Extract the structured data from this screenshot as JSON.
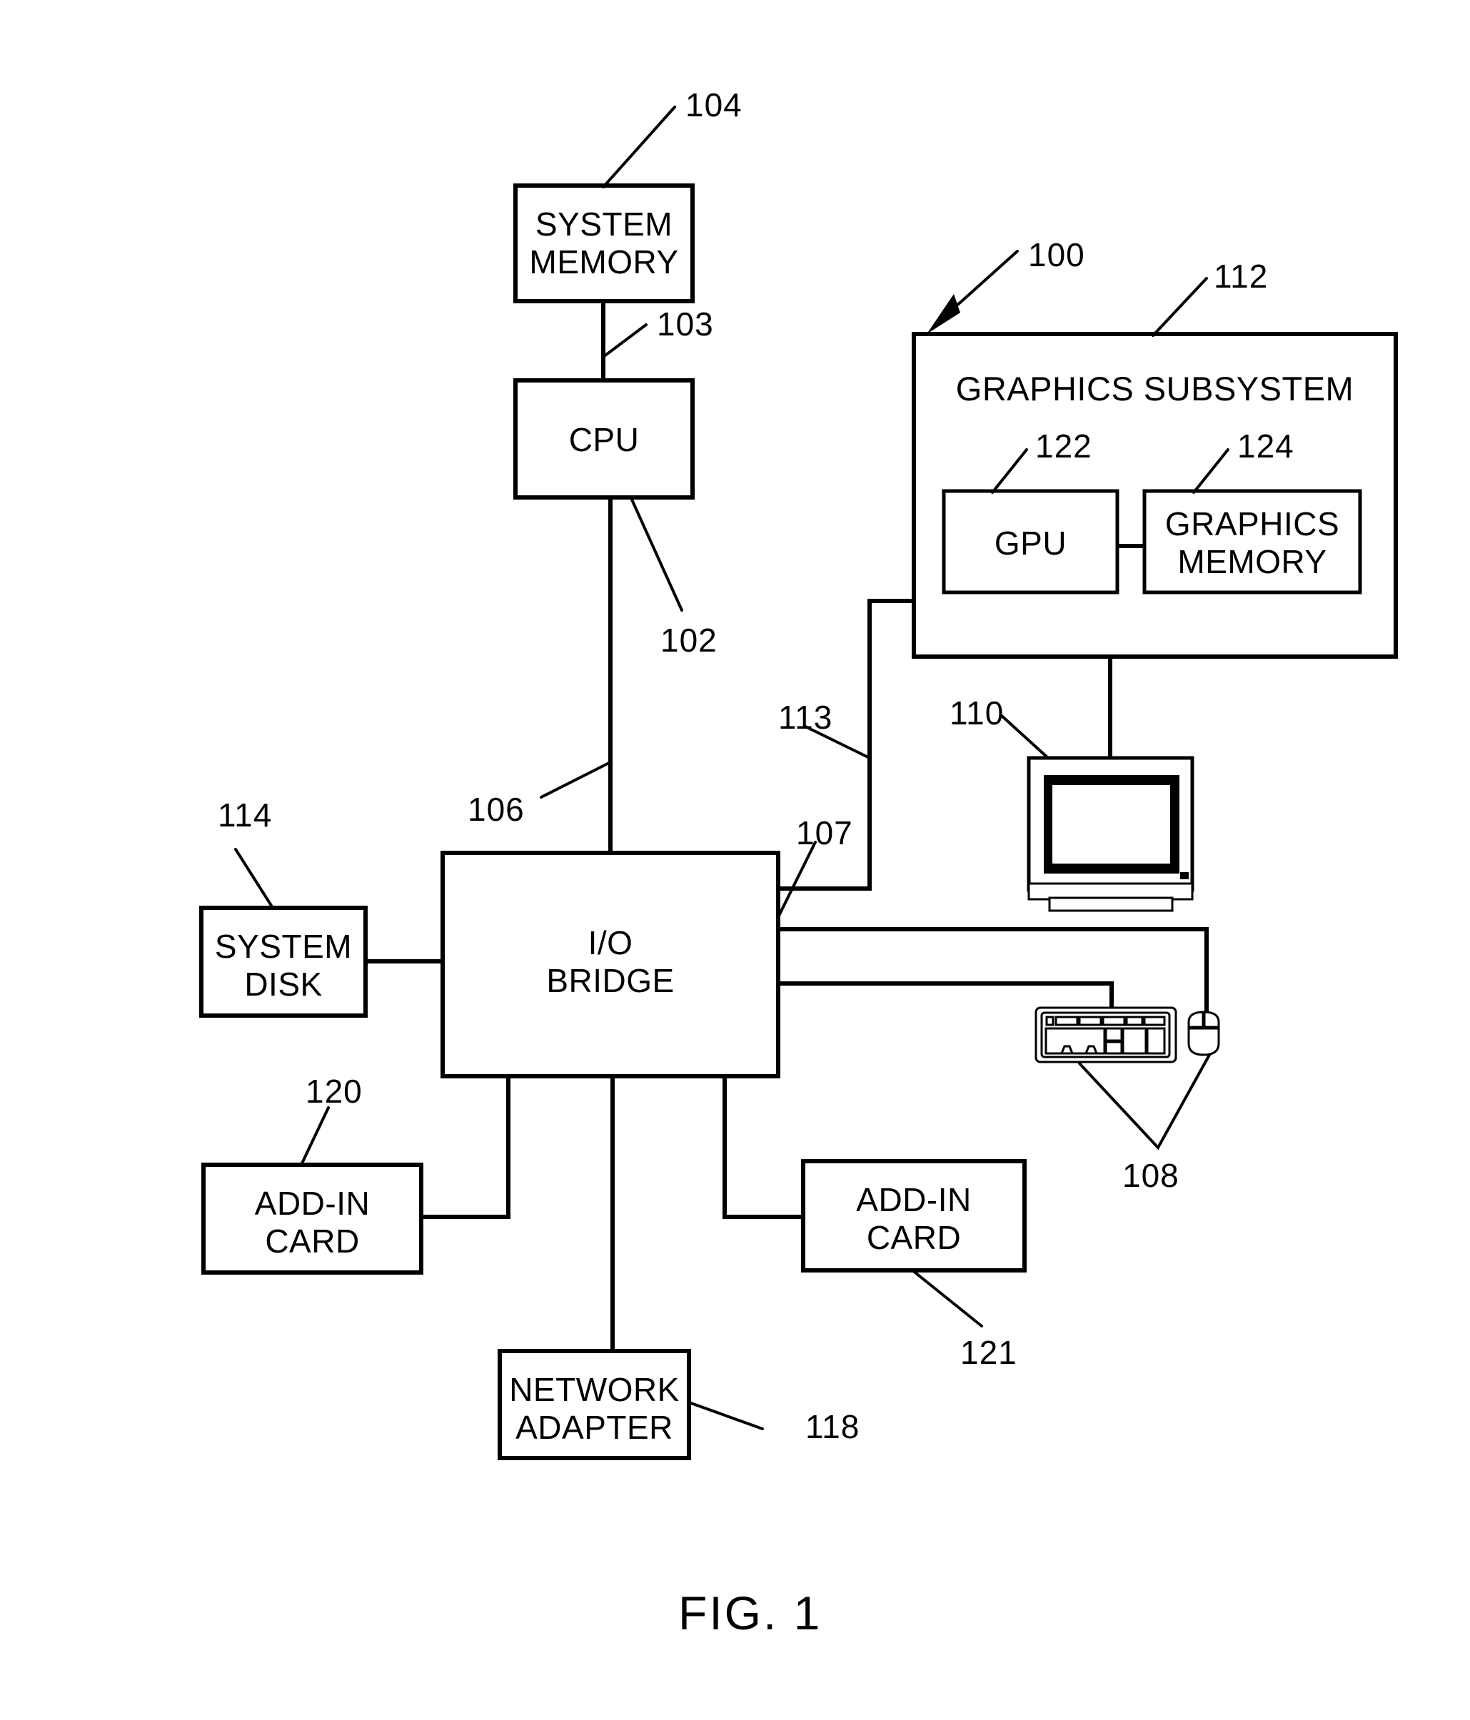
{
  "figure": {
    "caption": "FIG. 1",
    "title": "Computer system block diagram"
  },
  "blocks": {
    "system_memory": {
      "label": "SYSTEM\nMEMORY",
      "ref": "104"
    },
    "cpu": {
      "label": "CPU",
      "ref": "102"
    },
    "io_bridge": {
      "label": "I/O\nBRIDGE",
      "ref": ""
    },
    "system_disk": {
      "label": "SYSTEM\nDISK",
      "ref": "114"
    },
    "add_in_card_left": {
      "label": "ADD-IN\nCARD",
      "ref": "120"
    },
    "add_in_card_right": {
      "label": "ADD-IN\nCARD",
      "ref": "121"
    },
    "network_adapter": {
      "label": "NETWORK\nADAPTER",
      "ref": "118"
    },
    "graphics_subsystem": {
      "label": "GRAPHICS SUBSYSTEM",
      "ref": "112"
    },
    "gpu": {
      "label": "GPU",
      "ref": "122"
    },
    "graphics_memory": {
      "label": "GRAPHICS\nMEMORY",
      "ref": "124"
    }
  },
  "devices": {
    "display": {
      "ref": "110",
      "name": "display-monitor"
    },
    "input_devices": {
      "ref": "108",
      "name": "keyboard-and-mouse"
    }
  },
  "connections": {
    "memory_bus": {
      "ref": "103",
      "name": "system-memory-to-cpu-bus"
    },
    "cpu_to_bridge": {
      "ref": "106",
      "name": "cpu-to-io-bridge-bus"
    },
    "bridge_right_upper": {
      "ref": "107",
      "name": "io-bridge-upper-right-port"
    },
    "graphics_bus": {
      "ref": "113",
      "name": "io-bridge-to-graphics-subsystem-bus"
    }
  },
  "system": {
    "ref": "100",
    "name": "computer-system-overall"
  }
}
